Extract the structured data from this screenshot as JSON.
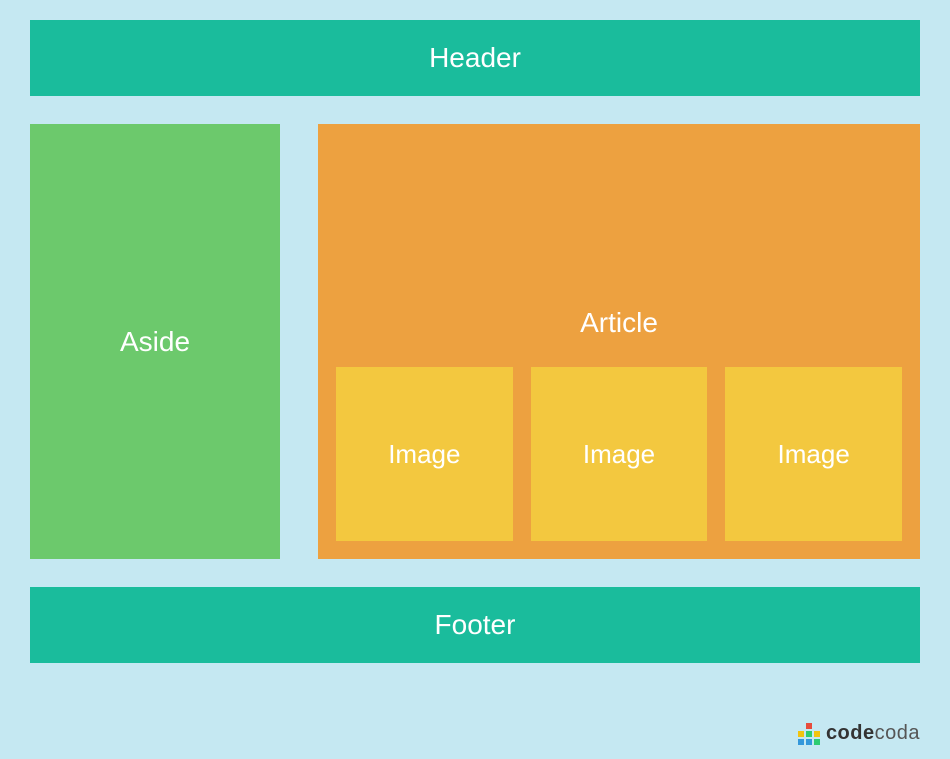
{
  "layout": {
    "header": "Header",
    "aside": "Aside",
    "article": "Article",
    "images": [
      "Image",
      "Image",
      "Image"
    ],
    "footer": "Footer"
  },
  "brand": {
    "name_bold": "code",
    "name_light": "coda"
  },
  "colors": {
    "background": "#c5e8f2",
    "header_footer": "#1abc9c",
    "aside": "#6cc96c",
    "article": "#eda140",
    "image": "#f3c83f"
  }
}
